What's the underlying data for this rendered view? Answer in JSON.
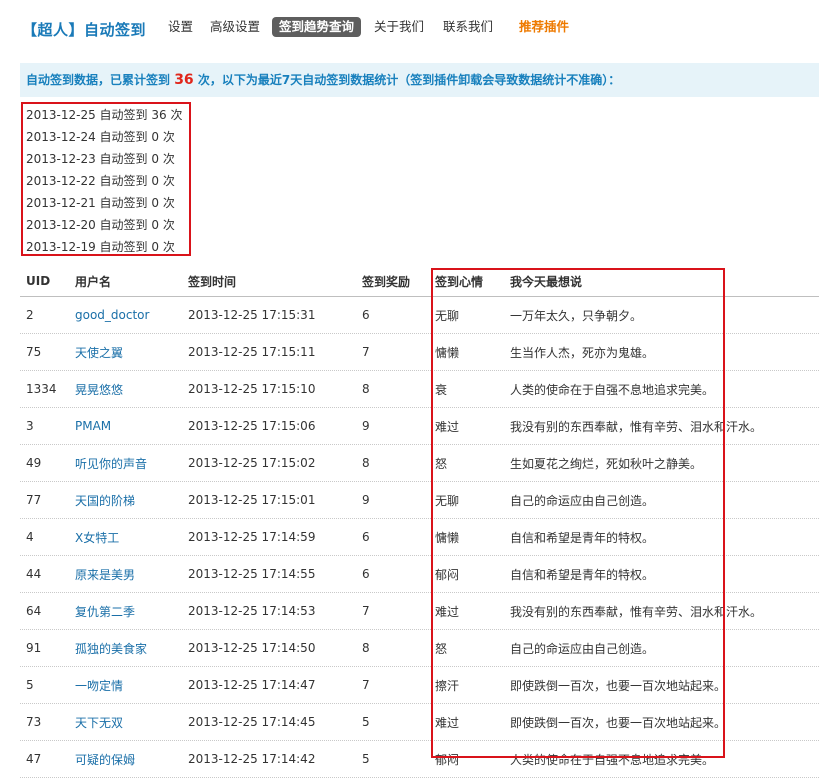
{
  "nav": {
    "brand": "【超人】自动签到",
    "items": [
      {
        "label": "设置"
      },
      {
        "label": "高级设置"
      },
      {
        "label": "签到趋势查询"
      },
      {
        "label": "关于我们"
      },
      {
        "label": "联系我们"
      },
      {
        "label": "推荐插件"
      }
    ],
    "active": "签到趋势查询"
  },
  "notice": {
    "prefix": "自动签到数据，已累计签到 ",
    "count": "36",
    "suffix": " 次，以下为最近7天自动签到数据统计（签到插件卸载会导致数据统计不准确）："
  },
  "stats": [
    "2013-12-25 自动签到 36 次",
    "2013-12-24 自动签到 0 次",
    "2013-12-23 自动签到 0 次",
    "2013-12-22 自动签到 0 次",
    "2013-12-21 自动签到 0 次",
    "2013-12-20 自动签到 0 次",
    "2013-12-19 自动签到 0 次"
  ],
  "table": {
    "headers": {
      "uid": "UID",
      "name": "用户名",
      "time": "签到时间",
      "reward": "签到奖励",
      "mood": "签到心情",
      "say": "我今天最想说"
    },
    "rows": [
      {
        "uid": "2",
        "name": "good_doctor",
        "time": "2013-12-25 17:15:31",
        "reward": "6",
        "mood": "无聊",
        "say": "一万年太久，只争朝夕。"
      },
      {
        "uid": "75",
        "name": "天使之翼",
        "time": "2013-12-25 17:15:11",
        "reward": "7",
        "mood": "慵懒",
        "say": "生当作人杰，死亦为鬼雄。"
      },
      {
        "uid": "1334",
        "name": "晃晃悠悠",
        "time": "2013-12-25 17:15:10",
        "reward": "8",
        "mood": "衰",
        "say": "人类的使命在于自强不息地追求完美。"
      },
      {
        "uid": "3",
        "name": "PMAM",
        "time": "2013-12-25 17:15:06",
        "reward": "9",
        "mood": "难过",
        "say": "我没有别的东西奉献，惟有辛劳、泪水和汗水。"
      },
      {
        "uid": "49",
        "name": "听见你的声音",
        "time": "2013-12-25 17:15:02",
        "reward": "8",
        "mood": "怒",
        "say": "生如夏花之绚烂，死如秋叶之静美。"
      },
      {
        "uid": "77",
        "name": "天国的阶梯",
        "time": "2013-12-25 17:15:01",
        "reward": "9",
        "mood": "无聊",
        "say": "自己的命运应由自己创造。"
      },
      {
        "uid": "4",
        "name": "X女特工",
        "time": "2013-12-25 17:14:59",
        "reward": "6",
        "mood": "慵懒",
        "say": "自信和希望是青年的特权。"
      },
      {
        "uid": "44",
        "name": "原来是美男",
        "time": "2013-12-25 17:14:55",
        "reward": "6",
        "mood": "郁闷",
        "say": "自信和希望是青年的特权。"
      },
      {
        "uid": "64",
        "name": "复仇第二季",
        "time": "2013-12-25 17:14:53",
        "reward": "7",
        "mood": "难过",
        "say": "我没有别的东西奉献，惟有辛劳、泪水和汗水。"
      },
      {
        "uid": "91",
        "name": "孤独的美食家",
        "time": "2013-12-25 17:14:50",
        "reward": "8",
        "mood": "怒",
        "say": "自己的命运应由自己创造。"
      },
      {
        "uid": "5",
        "name": "一吻定情",
        "time": "2013-12-25 17:14:47",
        "reward": "7",
        "mood": "擦汗",
        "say": "即使跌倒一百次，也要一百次地站起来。"
      },
      {
        "uid": "73",
        "name": "天下无双",
        "time": "2013-12-25 17:14:45",
        "reward": "5",
        "mood": "难过",
        "say": "即使跌倒一百次，也要一百次地站起来。"
      },
      {
        "uid": "47",
        "name": "可疑的保姆",
        "time": "2013-12-25 17:14:42",
        "reward": "5",
        "mood": "郁闷",
        "say": "人类的使命在于自强不息地追求完美。"
      }
    ]
  },
  "colors": {
    "brand": "#1a7ab8",
    "active_tab_bg": "#5e5e5e",
    "recommend": "#ee7a00",
    "notice_bg": "#e6f3f9",
    "count": "#e0261b",
    "highlight_border": "#d9131a"
  }
}
